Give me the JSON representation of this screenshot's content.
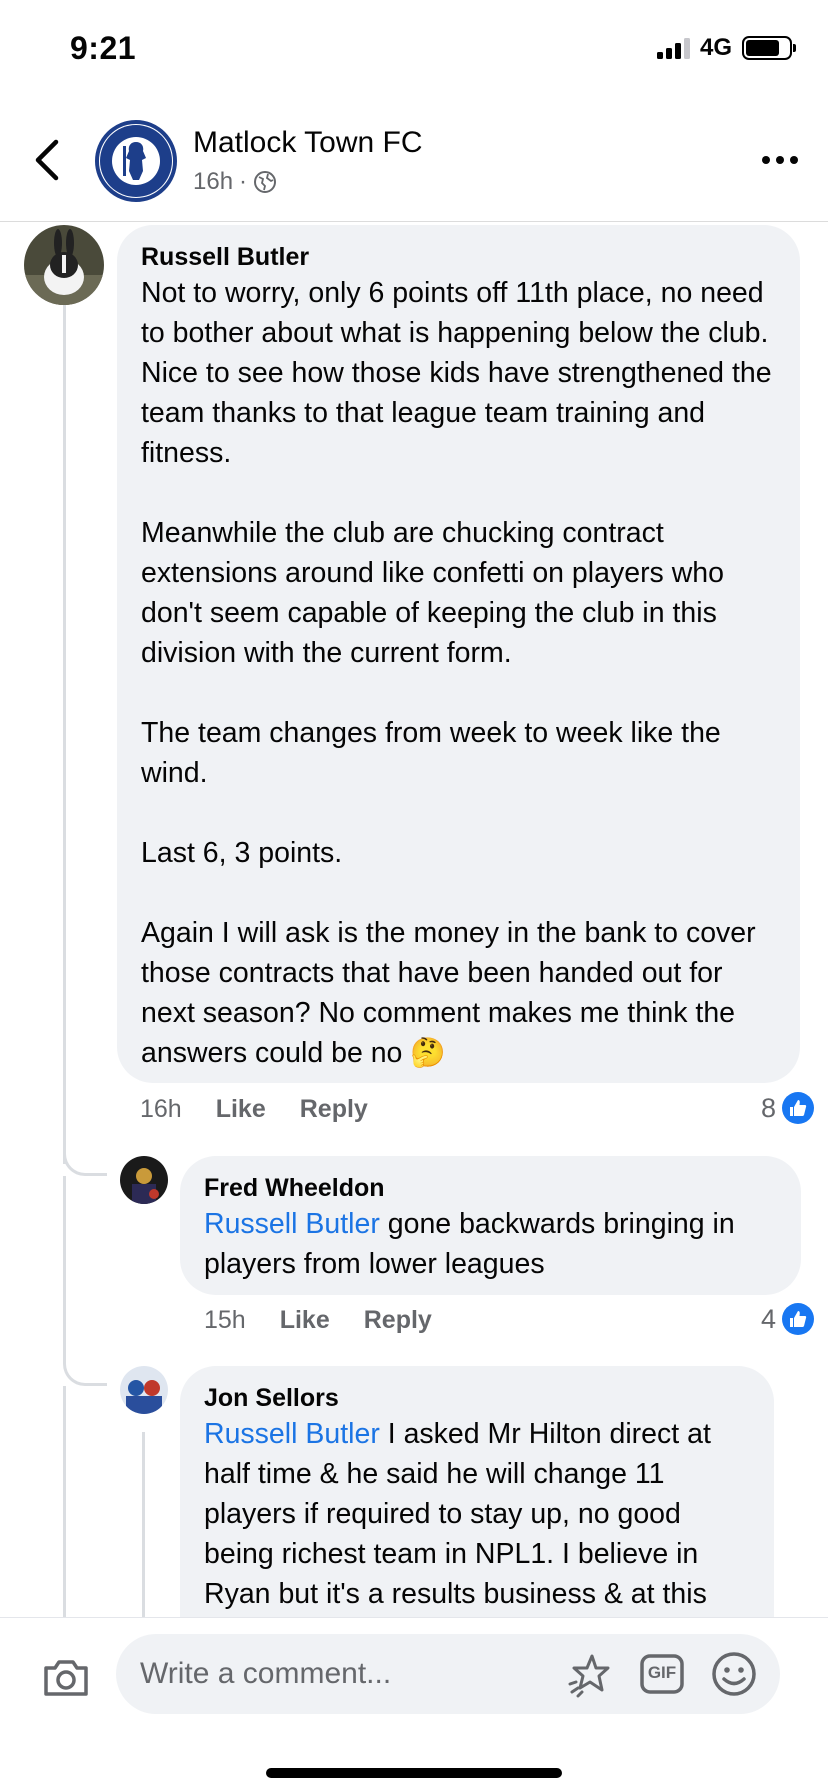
{
  "status_bar": {
    "time": "9:21",
    "network": "4G"
  },
  "header": {
    "page_name": "Matlock Town FC",
    "time": "16h",
    "separator": "·",
    "logo_text_top": "MATLOCK TOWN",
    "logo_text_bottom": "THE GLADIATORS"
  },
  "comments": [
    {
      "author": "Russell Butler",
      "text": "Not to worry, only 6 points off 11th place, no need to bother about what is happening below the club.  Nice to see how those kids have strengthened the team thanks to that league team training and fitness.\n\nMeanwhile the club are chucking contract extensions around like confetti on players who don't seem capable of keeping the club in this division with the current form.\n\nThe team changes from week to week like the wind.\n\nLast 6, 3 points.\n\nAgain I will ask is the money in the bank to cover those contracts that have been handed out for next season? No comment makes me think the answers could be no 🤔",
      "time": "16h",
      "like_label": "Like",
      "reply_label": "Reply",
      "likes": "8"
    },
    {
      "author": "Fred Wheeldon",
      "mention": "Russell Butler",
      "text": " gone backwards bringing in players from lower leagues",
      "time": "15h",
      "like_label": "Like",
      "reply_label": "Reply",
      "likes": "4"
    },
    {
      "author": "Jon Sellors",
      "mention": "Russell Butler",
      "text": " I asked Mr Hilton direct at half time & he said he will change 11 players if required to stay up, no good being richest team in NPL1. I believe in Ryan but it's a results business & at this"
    }
  ],
  "composer": {
    "placeholder": "Write a comment...",
    "gif_label": "GIF"
  },
  "colors": {
    "link": "#1b74e4",
    "like_blue": "#1877f2",
    "bubble": "#f0f2f5",
    "muted": "#65676b"
  },
  "icons": [
    "back-chevron-icon",
    "globe-icon",
    "more-icon",
    "like-thumb-icon",
    "camera-icon",
    "avatar-sticker-icon",
    "gif-icon",
    "emoji-icon"
  ]
}
